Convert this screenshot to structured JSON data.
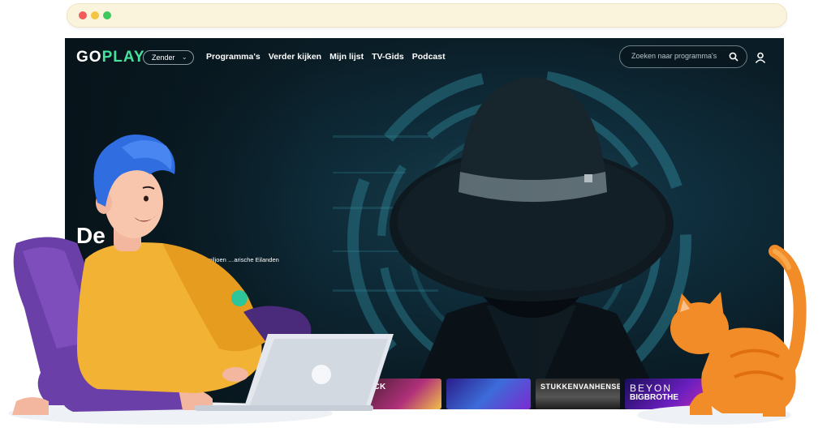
{
  "browser": {
    "dots": [
      "close",
      "minimize",
      "maximize"
    ]
  },
  "nav": {
    "logo_left": "GO",
    "logo_right": "PLAY",
    "zender_label": "Zender",
    "links": [
      "Programma's",
      "Verder kijken",
      "Mijn lijst",
      "TV-Gids",
      "Podcast"
    ],
    "search_placeholder": "Zoeken naar programma's"
  },
  "hero": {
    "title": "De",
    "description": "en een miljoen …arische Eilanden in het"
  },
  "thumbnails": [
    {
      "line1": "FUCK",
      "line2": ""
    },
    {
      "line1": "",
      "line2": ""
    },
    {
      "line1": "STUKKENVANHENSEN",
      "line2": ""
    },
    {
      "line1": "BEYON",
      "line2": "BIGBROTHE"
    }
  ],
  "colors": {
    "accent": "#46e29c",
    "background": "#0b1a22",
    "chrome": "#fbf4dd"
  }
}
